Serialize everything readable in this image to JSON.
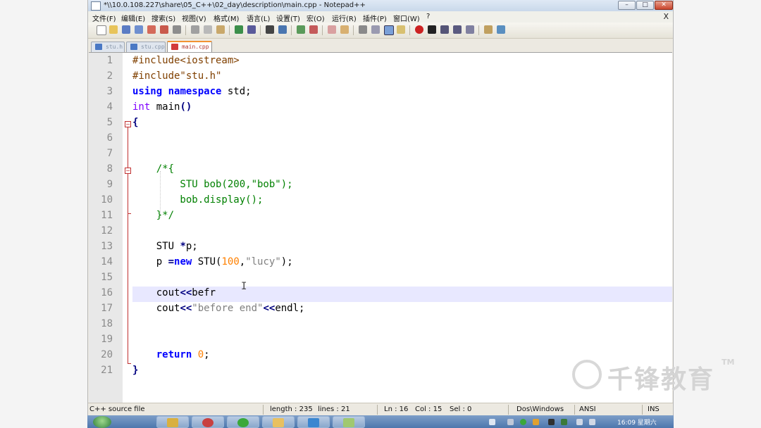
{
  "window": {
    "title": "*\\\\10.0.108.227\\share\\05_C++\\02_day\\description\\main.cpp - Notepad++",
    "minimize_glyph": "–",
    "maximize_glyph": "□",
    "close_glyph": "✕"
  },
  "menu": {
    "items": [
      "文件(F)",
      "编辑(E)",
      "搜索(S)",
      "视图(V)",
      "格式(M)",
      "语言(L)",
      "设置(T)",
      "宏(O)",
      "运行(R)",
      "插件(P)",
      "窗口(W)",
      "?"
    ],
    "close_doc": "X"
  },
  "toolbar": {
    "icons": [
      "new-file-icon",
      "open-file-icon",
      "save-icon",
      "save-all-icon",
      "close-icon",
      "close-all-icon",
      "print-icon",
      "cut-icon",
      "copy-icon",
      "paste-icon",
      "undo-icon",
      "redo-icon",
      "find-icon",
      "replace-icon",
      "zoom-in-icon",
      "zoom-out-icon",
      "sync-vertical-icon",
      "sync-horizontal-icon",
      "word-wrap-icon",
      "all-chars-icon",
      "indent-guide-icon",
      "user-lang-icon",
      "record-macro-icon",
      "stop-record-icon",
      "play-macro-icon",
      "run-macro-multiple-icon",
      "save-macro-icon",
      "doc-map-icon",
      "spellcheck-icon"
    ]
  },
  "tabs": [
    {
      "label": "stu.h",
      "active": false
    },
    {
      "label": "stu.cpp",
      "active": false
    },
    {
      "label": "main.cpp",
      "active": true
    }
  ],
  "editor": {
    "line_numbers": [
      "1",
      "2",
      "3",
      "4",
      "5",
      "6",
      "7",
      "8",
      "9",
      "10",
      "11",
      "12",
      "13",
      "14",
      "15",
      "16",
      "17",
      "18",
      "19",
      "20",
      "21"
    ],
    "current_line": "16",
    "cursor_glyph": "I"
  },
  "status": {
    "file_type": "C++ source file",
    "length": "length : 235",
    "lines": "lines : 21",
    "ln": "Ln : 16",
    "col": "Col : 15",
    "sel": "Sel : 0",
    "eol": "Dos\\Windows",
    "encoding": "ANSI",
    "mode": "INS"
  },
  "taskbar": {
    "clock": "16:09 星期六"
  },
  "watermark": {
    "text": "千锋教育",
    "tm": "TM"
  }
}
